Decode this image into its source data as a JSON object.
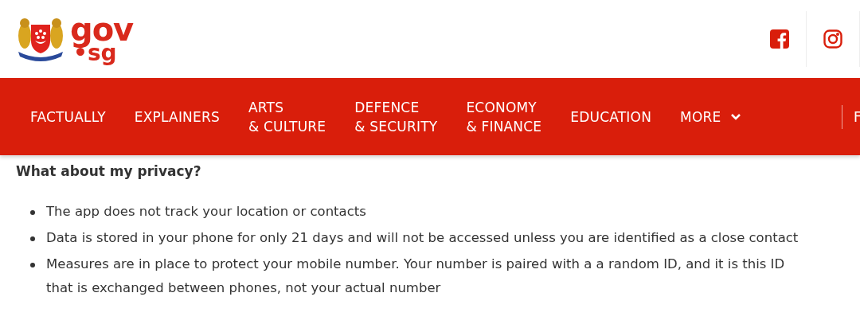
{
  "logo": {
    "line_1": "gov",
    "line_2": "•sg"
  },
  "nav": {
    "items": [
      {
        "lines": [
          "FACTUALLY"
        ],
        "has_caret": false
      },
      {
        "lines": [
          "EXPLAINERS"
        ],
        "has_caret": false
      },
      {
        "lines": [
          "ARTS",
          "& CULTURE"
        ],
        "has_caret": false
      },
      {
        "lines": [
          "DEFENCE",
          "& SECURITY"
        ],
        "has_caret": false
      },
      {
        "lines": [
          "ECONOMY",
          "& FINANCE"
        ],
        "has_caret": false
      },
      {
        "lines": [
          "EDUCATION"
        ],
        "has_caret": false
      },
      {
        "lines": [
          "MORE"
        ],
        "has_caret": true
      }
    ],
    "cut_item": "F"
  },
  "content": {
    "heading": "What about my privacy?",
    "bullets": [
      "The app does not track your location or contacts",
      "Data is stored in your phone for only 21 days and will not be accessed unless you are identified as a close contact",
      "Measures are in place to protect your mobile number. Your number is paired with a a random ID, and it is this ID that is exchanged between phones, not your actual number"
    ]
  }
}
